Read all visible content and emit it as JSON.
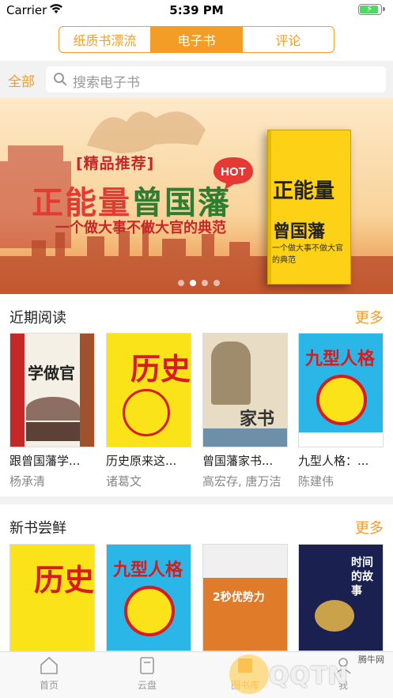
{
  "status_bar": {
    "carrier": "Carrier",
    "time": "5:39 PM",
    "battery_level": 0.9
  },
  "segments": [
    {
      "label": "纸质书漂流",
      "active": false
    },
    {
      "label": "电子书",
      "active": true
    },
    {
      "label": "评论",
      "active": false
    }
  ],
  "search": {
    "all_label": "全部",
    "placeholder": "搜索电子书"
  },
  "banner": {
    "tag": "[精品推荐]",
    "title_part1": "正能量",
    "title_part2": "曾国藩",
    "subtitle": "一个做大事不做大官的典范",
    "hot_badge": "HOT",
    "book_title1": "正能量",
    "book_title2": "曾国藩",
    "book_caption": "一个做大事不做大官的典范",
    "page_count": 4,
    "active_page": 1
  },
  "recent": {
    "title": "近期阅读",
    "more": "更多",
    "books": [
      {
        "title": "跟曾国藩学...",
        "author": "杨承清",
        "cover_text": "学做官"
      },
      {
        "title": "历史原来这...",
        "author": "诸葛文",
        "cover_text": "历史"
      },
      {
        "title": "曾国藩家书...",
        "author": "高宏存, 唐万洁",
        "cover_text": "家书"
      },
      {
        "title": "九型人格：...",
        "author": "陈建伟",
        "cover_text": "九型人格"
      }
    ]
  },
  "new_books": {
    "title": "新书尝鲜",
    "more": "更多",
    "books": [
      {
        "cover_text": "历史"
      },
      {
        "cover_text": "九型人格"
      },
      {
        "cover_text": "2秒优势力"
      },
      {
        "cover_text": "时间的故事"
      }
    ]
  },
  "tabs": [
    {
      "label": "首页",
      "icon": "home-icon",
      "active": false
    },
    {
      "label": "云盘",
      "icon": "cloud-disk-icon",
      "active": false
    },
    {
      "label": "图书库",
      "icon": "library-icon",
      "active": true
    },
    {
      "label": "我",
      "icon": "profile-icon",
      "active": false
    }
  ],
  "watermark": {
    "brand": "QQTN",
    "site": "腾牛网"
  },
  "colors": {
    "accent": "#f39c26",
    "background_gray": "#f2f2f2"
  }
}
